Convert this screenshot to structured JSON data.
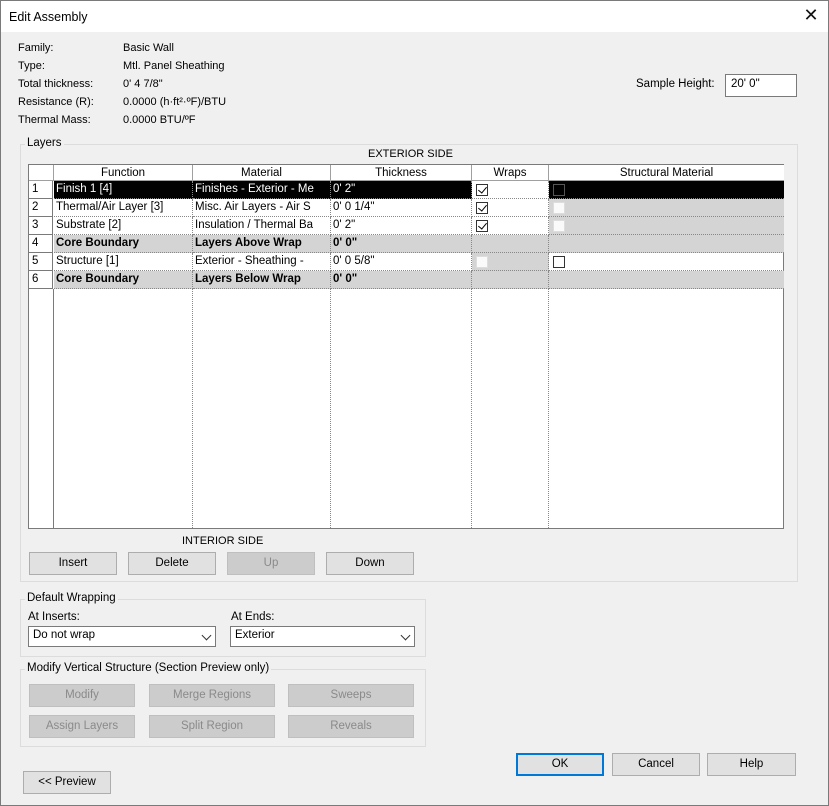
{
  "window": {
    "title": "Edit Assembly",
    "close_glyph": "✕"
  },
  "info": {
    "family_label": "Family:",
    "family_value": "Basic Wall",
    "type_label": "Type:",
    "type_value": "Mtl. Panel Sheathing",
    "thickness_label": "Total thickness:",
    "thickness_value": "0'  4 7/8\"",
    "resistance_label": "Resistance (R):",
    "resistance_value": "0.0000 (h·ft²·ºF)/BTU",
    "mass_label": "Thermal Mass:",
    "mass_value": "0.0000 BTU/ºF",
    "sample_height_label": "Sample Height:",
    "sample_height_value": "20'  0\""
  },
  "layers": {
    "group_label": "Layers",
    "exterior_label": "EXTERIOR SIDE",
    "interior_label": "INTERIOR SIDE",
    "columns": [
      "Function",
      "Material",
      "Thickness",
      "Wraps",
      "Structural Material"
    ],
    "rows": [
      {
        "num": "1",
        "function": "Finish 1 [4]",
        "material": "Finishes - Exterior - Me",
        "thickness": "0'  2\"",
        "wraps": "checked",
        "structural": "black",
        "style": "selected"
      },
      {
        "num": "2",
        "function": "Thermal/Air Layer [3]",
        "material": "Misc. Air Layers - Air S",
        "thickness": "0'  0 1/4\"",
        "wraps": "checked",
        "structural": "dim",
        "style": "gray"
      },
      {
        "num": "3",
        "function": "Substrate [2]",
        "material": "Insulation / Thermal Ba",
        "thickness": "0'  2\"",
        "wraps": "checked",
        "structural": "dim",
        "style": "gray"
      },
      {
        "num": "4",
        "function": "Core Boundary",
        "material": "Layers Above Wrap",
        "thickness": "0'  0\"",
        "wraps": "none",
        "structural": "none",
        "style": "boundary"
      },
      {
        "num": "5",
        "function": "Structure [1]",
        "material": "Exterior - Sheathing -",
        "thickness": "0'  0 5/8\"",
        "wraps": "dim",
        "structural": "empty",
        "style": "normal"
      },
      {
        "num": "6",
        "function": "Core Boundary",
        "material": "Layers Below Wrap",
        "thickness": "0'  0\"",
        "wraps": "none",
        "structural": "none",
        "style": "boundary"
      }
    ],
    "buttons": {
      "insert": "Insert",
      "delete": "Delete",
      "up": "Up",
      "down": "Down"
    }
  },
  "default_wrapping": {
    "group_label": "Default Wrapping",
    "at_inserts_label": "At Inserts:",
    "at_inserts_value": "Do not wrap",
    "at_ends_label": "At  Ends:",
    "at_ends_value": "Exterior"
  },
  "modify_vertical": {
    "group_label": "Modify Vertical Structure (Section Preview only)",
    "buttons": {
      "modify": "Modify",
      "merge_regions": "Merge Regions",
      "sweeps": "Sweeps",
      "assign_layers": "Assign Layers",
      "split_region": "Split Region",
      "reveals": "Reveals"
    }
  },
  "footer": {
    "ok": "OK",
    "cancel": "Cancel",
    "help": "Help",
    "preview": "<< Preview"
  }
}
